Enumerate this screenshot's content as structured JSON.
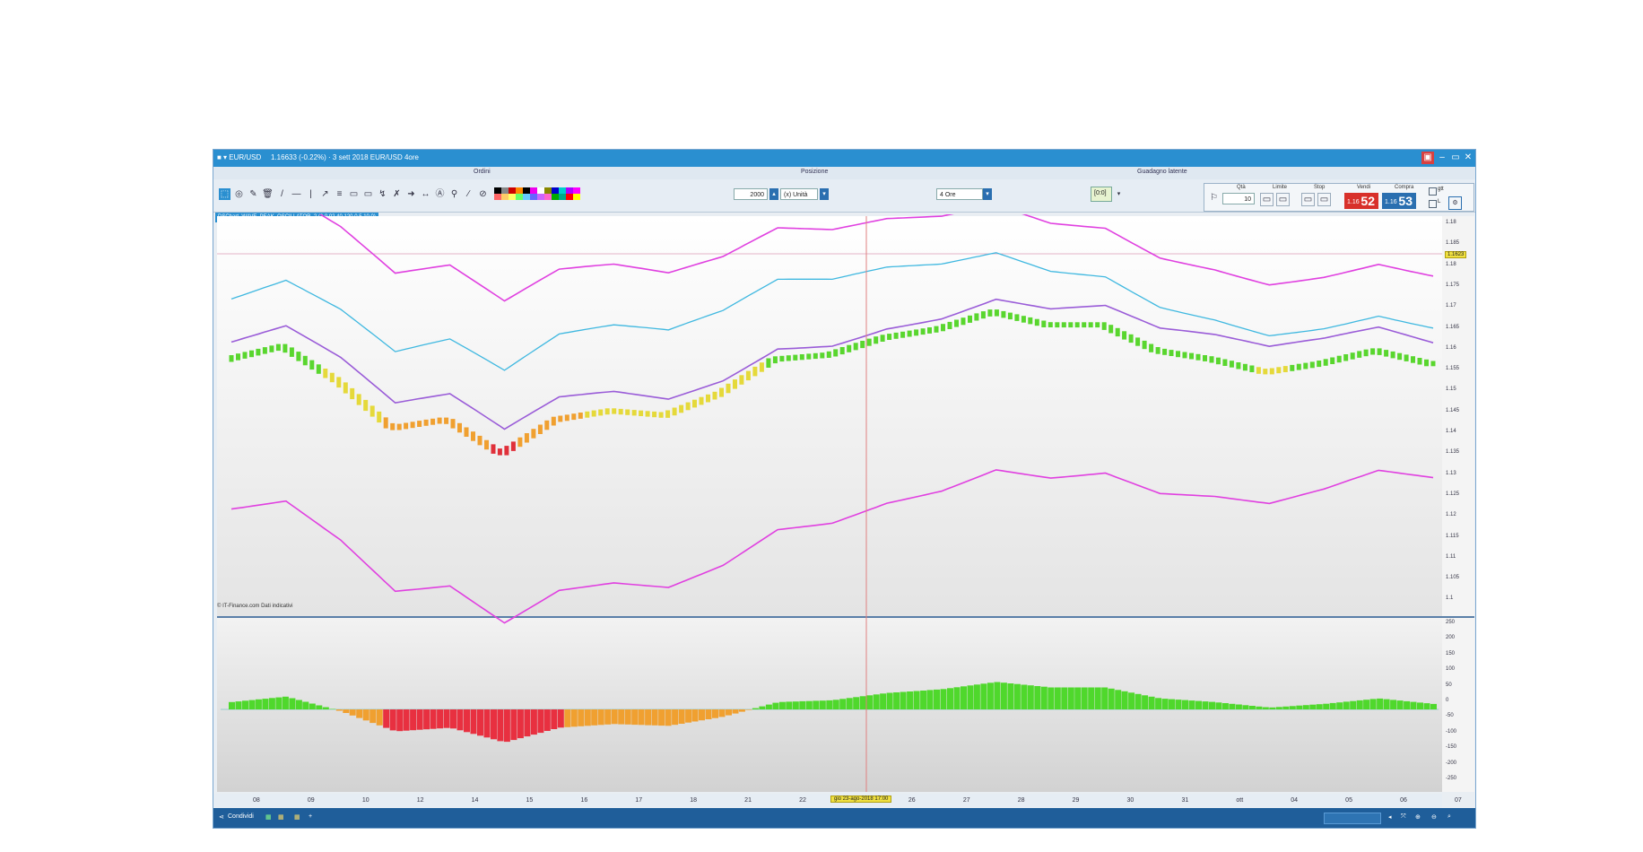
{
  "window": {
    "title_left": "■ ▾ EUR/USD",
    "title_info": "1.16633 (-0.22%) · 3 sett 2018 EUR/USD 4ore",
    "controls": [
      "▣",
      "–",
      "▭",
      "✕"
    ]
  },
  "labels_row": {
    "ordini": "Ordini",
    "posizione": "Posizione",
    "guadagno": "Guadagno latente"
  },
  "toolbar": {
    "units": "2000",
    "units_type": "(x) Unità",
    "timeframe": "4 Ore",
    "zoom_badge": "[0:0]",
    "tools": [
      "⬚",
      "◎",
      "✎",
      "🗑",
      "/",
      "—",
      "|",
      "↗",
      "≡",
      "▭",
      "▭",
      "↯",
      "✗",
      "➜",
      "↔",
      "Ⓐ",
      "⚲",
      "∕",
      "⊘"
    ]
  },
  "order_panel": {
    "qty_label": "Qtà",
    "qty_value": "10",
    "limit_label": "Limite",
    "stop_label": "Stop",
    "sell_label": "Vendi",
    "sell_price_small": "1.16",
    "sell_price_big": "52",
    "buy_label": "Compra",
    "buy_price_small": "1.16",
    "buy_price_big": "53",
    "check1": "gtt",
    "check2": "L"
  },
  "indicator_tab": "DSChart_WAVE_PEAK_OSCILLATOR_2 (2,0.02,40,120,0.5,10,0)",
  "credit": "© IT-Finance.com  Dati indicativi",
  "price_axis": [
    "1.18",
    "1.185",
    "1.18",
    "1.175",
    "1.17",
    "1.165",
    "1.16",
    "1.155",
    "1.15",
    "1.145",
    "1.14",
    "1.135",
    "1.13",
    "1.125",
    "1.12",
    "1.115",
    "1.11",
    "1.105",
    "1.1"
  ],
  "price_tag": "1.1623",
  "osc_axis": [
    "250",
    "200",
    "150",
    "100",
    "50",
    "0",
    "-50",
    "-100",
    "-150",
    "-200",
    "-250"
  ],
  "time_axis": [
    "08",
    "09",
    "10",
    "12",
    "14",
    "15",
    "16",
    "17",
    "18",
    "21",
    "22",
    "23",
    "26",
    "27",
    "28",
    "29",
    "30",
    "31",
    "ott",
    "04",
    "05",
    "06",
    "07"
  ],
  "cursor_date": "gio 23-ago-2018 17:00",
  "statusbar": {
    "left": "Condividi",
    "right_box": ""
  },
  "colors": {
    "title": "#2a8fd0",
    "magenta": "#e040e0",
    "purple": "#9a5cd8",
    "cyan": "#3fb8e0",
    "sell": "#d8302a",
    "buy": "#2a6fb0"
  },
  "chart_data": {
    "type": "line",
    "x": [
      "08",
      "09",
      "10",
      "12",
      "14",
      "15",
      "16",
      "17",
      "18",
      "21",
      "22",
      "23",
      "26",
      "27",
      "28",
      "29",
      "30",
      "31",
      "ott",
      "04",
      "05",
      "06",
      "07"
    ],
    "series": [
      {
        "name": "",
        "values": [
          1.158,
          1.161,
          1.153,
          1.142,
          1.144,
          1.136,
          1.144,
          1.146,
          1.145,
          1.15,
          1.158,
          1.159,
          1.163,
          1.165,
          1.169,
          1.166,
          1.166,
          1.16,
          1.158,
          1.155,
          1.157,
          1.16,
          1.157
        ]
      }
    ],
    "ylim": [
      1.1,
      1.19
    ],
    "xlabel": "",
    "ylabel": ""
  }
}
